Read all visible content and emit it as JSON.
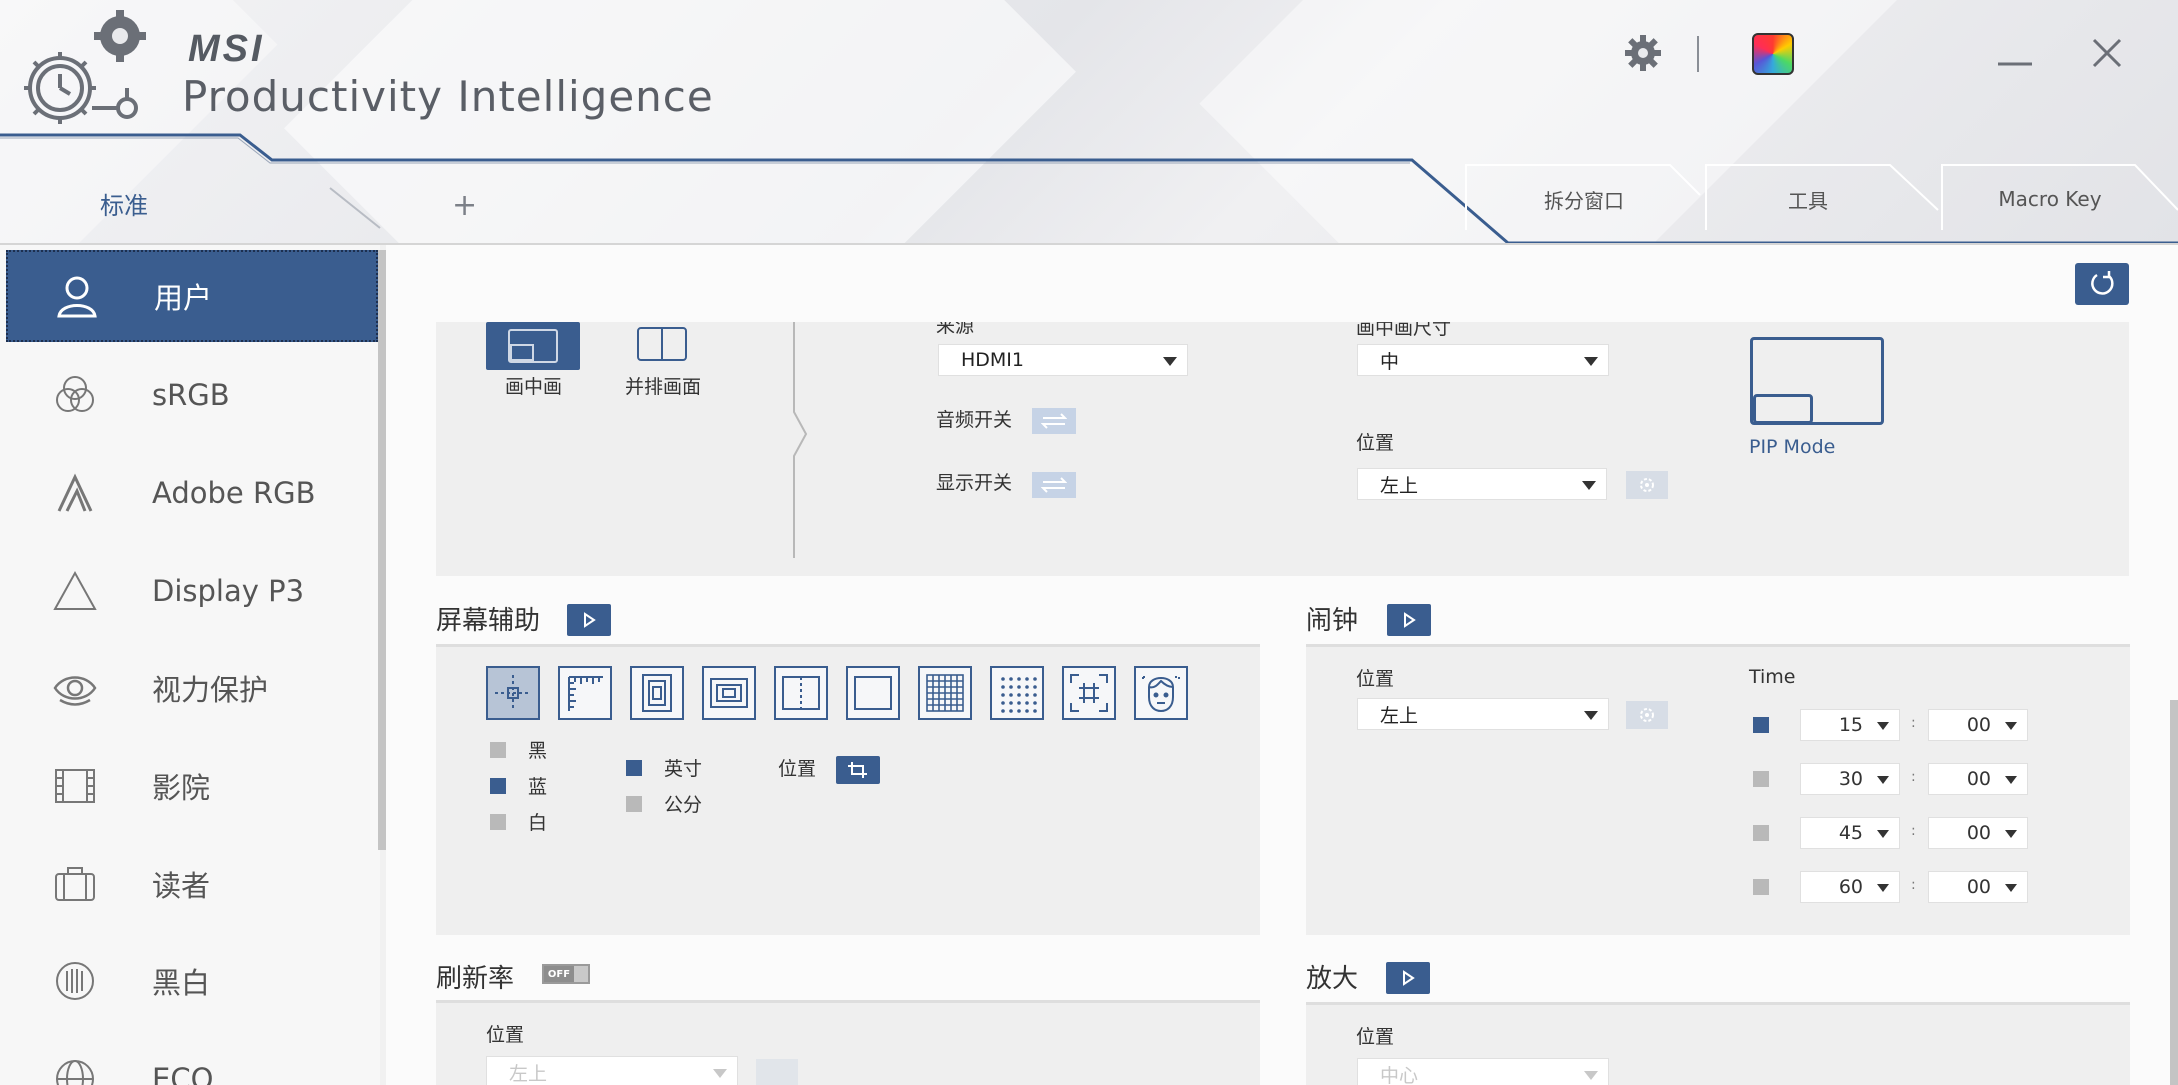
{
  "app": {
    "brand": "MSI",
    "title": "Productivity Intelligence"
  },
  "tabs": {
    "standard": "标准",
    "add": "+",
    "split_window": "拆分窗口",
    "tools": "工具",
    "macro_key": "Macro Key"
  },
  "sidebar": {
    "items": [
      {
        "label": "用户",
        "icon": "user-icon",
        "active": true
      },
      {
        "label": "sRGB",
        "icon": "srgb-icon"
      },
      {
        "label": "Adobe RGB",
        "icon": "adobe-rgb-icon"
      },
      {
        "label": "Display P3",
        "icon": "display-p3-icon"
      },
      {
        "label": "视力保护",
        "icon": "eye-care-icon"
      },
      {
        "label": "影院",
        "icon": "cinema-icon"
      },
      {
        "label": "读者",
        "icon": "reader-icon"
      },
      {
        "label": "黑白",
        "icon": "black-white-icon"
      },
      {
        "label": "ECO",
        "icon": "eco-icon"
      }
    ]
  },
  "pip": {
    "mode_pip": "画中画",
    "mode_pbp": "并排画面",
    "source_label": "来源",
    "source_value": "HDMI1",
    "audio_label": "音频开关",
    "display_label": "显示开关",
    "size_label": "画中画尺寸",
    "size_value": "中",
    "position_label": "位置",
    "position_value": "左上",
    "preview_label": "PIP Mode"
  },
  "screen_assist": {
    "title": "屏幕辅助",
    "colors": [
      "黑",
      "蓝",
      "白"
    ],
    "units": [
      "英寸",
      "公分"
    ],
    "position_label": "位置"
  },
  "alarm": {
    "title": "闹钟",
    "position_label": "位置",
    "position_value": "左上",
    "time_label": "Time",
    "rows": [
      {
        "minutes": "15",
        "seconds": "00",
        "checked": true
      },
      {
        "minutes": "30",
        "seconds": "00",
        "checked": false
      },
      {
        "minutes": "45",
        "seconds": "00",
        "checked": false
      },
      {
        "minutes": "60",
        "seconds": "00",
        "checked": false
      }
    ],
    "separator": ":"
  },
  "refresh": {
    "title": "刷新率",
    "toggle": "OFF",
    "position_label": "位置",
    "position_value": "左上"
  },
  "magnify": {
    "title": "放大",
    "position_label": "位置",
    "position_value": "中心"
  },
  "colors": {
    "accent": "#3a5d8f",
    "panel": "#efefef"
  }
}
